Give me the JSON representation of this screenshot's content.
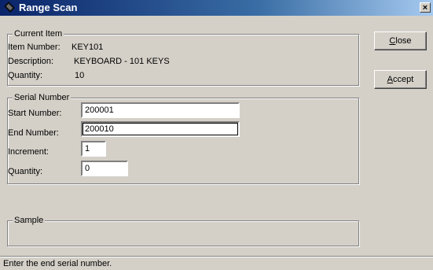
{
  "window": {
    "title": "Range Scan",
    "close_glyph": "×"
  },
  "current_item": {
    "legend": "Current Item",
    "item_number_label": "Item Number:",
    "item_number_value": "KEY101",
    "description_label": "Description:",
    "description_value": "KEYBOARD - 101 KEYS",
    "quantity_label": "Quantity:",
    "quantity_value": "10"
  },
  "serial_number": {
    "legend": "Serial Number",
    "start_label": "Start Number:",
    "start_value": "200001",
    "end_label": "End Number:",
    "end_value": "200010",
    "increment_label": "Increment:",
    "increment_value": "1",
    "quantity_label": "Quantity:",
    "quantity_value": "0"
  },
  "sample": {
    "legend": "Sample"
  },
  "buttons": {
    "close_first": "C",
    "close_rest": "lose",
    "accept_first": "A",
    "accept_rest": "ccept"
  },
  "status": {
    "text": "Enter the end serial number."
  },
  "icons": {
    "title_icon": "app-diamond-icon"
  },
  "colors": {
    "titlebar_start": "#0a246a",
    "titlebar_end": "#a6caf0",
    "face": "#d4d0c8"
  }
}
